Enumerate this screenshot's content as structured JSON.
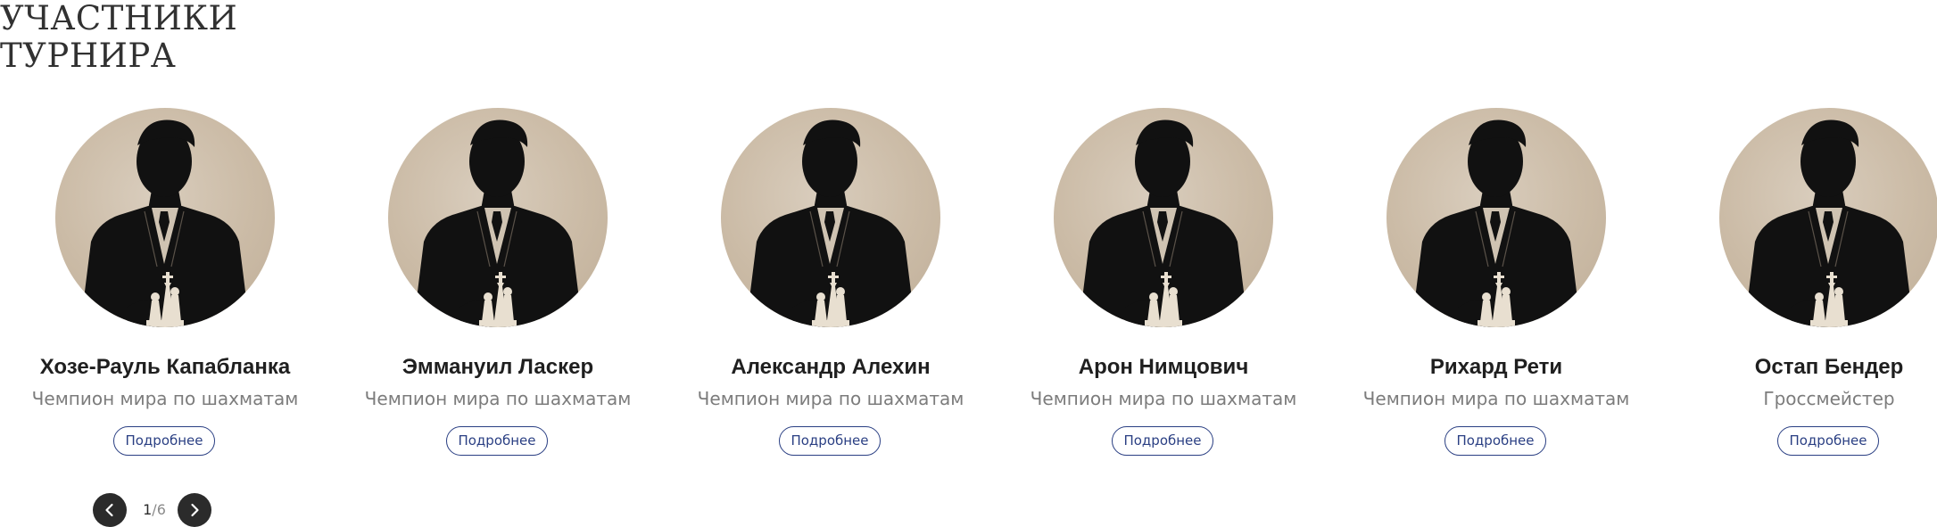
{
  "section": {
    "title_line1": "УЧАСТНИКИ",
    "title_line2": "ТУРНИРА"
  },
  "participants": [
    {
      "name": "Хозе-Рауль Капабланка",
      "title": "Чемпион мира по шахматам",
      "button": "Подробнее"
    },
    {
      "name": "Эммануил Ласкер",
      "title": "Чемпион мира по шахматам",
      "button": "Подробнее"
    },
    {
      "name": "Александр Алехин",
      "title": "Чемпион мира по шахматам",
      "button": "Подробнее"
    },
    {
      "name": "Арон Нимцович",
      "title": "Чемпион мира по шахматам",
      "button": "Подробнее"
    },
    {
      "name": "Рихард Рети",
      "title": "Чемпион мира по шахматам",
      "button": "Подробнее"
    },
    {
      "name": "Остап Бендер",
      "title": "Гроссмейстер",
      "button": "Подробнее"
    }
  ],
  "pager": {
    "current": "1",
    "separator": "/",
    "total": "6"
  },
  "colors": {
    "button_border": "#2a3f83",
    "pager_bg": "#2b2b2b",
    "avatar_bg": "#cbbba6"
  },
  "icons": {
    "prev": "chevron-left-icon",
    "next": "chevron-right-icon",
    "avatar": "silhouette-with-chess-pieces"
  }
}
